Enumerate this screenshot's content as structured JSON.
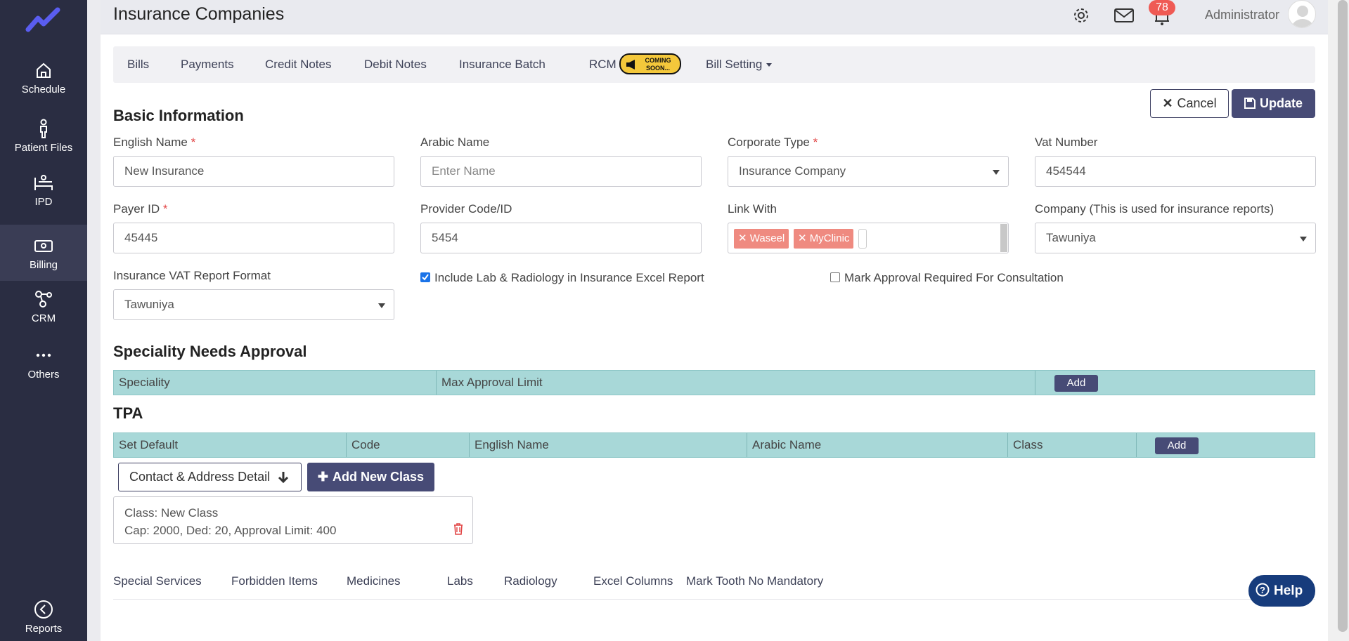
{
  "sidebar": {
    "items": [
      {
        "label": "Schedule",
        "icon": "home-icon"
      },
      {
        "label": "Patient Files",
        "icon": "person-icon"
      },
      {
        "label": "IPD",
        "icon": "bed-icon"
      },
      {
        "label": "Billing",
        "icon": "billing-icon"
      },
      {
        "label": "CRM",
        "icon": "crm-icon"
      },
      {
        "label": "Others",
        "icon": "more-icon"
      },
      {
        "label": "Reports",
        "icon": "back-circle-icon"
      }
    ],
    "active": "Billing"
  },
  "header": {
    "title": "Insurance Companies",
    "notification_count": "78",
    "user": "Administrator"
  },
  "tabs": [
    {
      "label": "Bills"
    },
    {
      "label": "Payments"
    },
    {
      "label": "Credit Notes"
    },
    {
      "label": "Debit Notes"
    },
    {
      "label": "Insurance Batch"
    },
    {
      "label": "RCM"
    },
    {
      "label": "Bill Setting"
    }
  ],
  "coming_soon": "COMING SOON...",
  "actions": {
    "cancel": "Cancel",
    "update": "Update"
  },
  "basic": {
    "heading": "Basic Information",
    "english_name": {
      "label": "English Name",
      "value": "New Insurance"
    },
    "arabic_name": {
      "label": "Arabic Name",
      "placeholder": "Enter Name"
    },
    "corporate_type": {
      "label": "Corporate Type",
      "value": "Insurance Company"
    },
    "vat_number": {
      "label": "Vat Number",
      "value": "454544"
    },
    "payer_id": {
      "label": "Payer ID",
      "value": "45445"
    },
    "provider_code": {
      "label": "Provider Code/ID",
      "value": "5454"
    },
    "link_with": {
      "label": "Link With",
      "chips": [
        "Waseel",
        "MyClinic"
      ]
    },
    "company": {
      "label": "Company (This is used for insurance reports)",
      "value": "Tawuniya"
    },
    "vat_report": {
      "label": "Insurance VAT Report Format",
      "value": "Tawuniya"
    },
    "include_lab": {
      "label": "Include Lab & Radiology in Insurance Excel Report",
      "checked": true
    },
    "mark_approval": {
      "label": "Mark Approval Required For Consultation",
      "checked": false
    }
  },
  "speciality": {
    "heading": "Speciality Needs Approval",
    "columns": [
      "Speciality",
      "Max Approval Limit"
    ],
    "add": "Add"
  },
  "tpa": {
    "heading": "TPA",
    "columns": [
      "Set Default",
      "Code",
      "English Name",
      "Arabic Name",
      "Class"
    ],
    "add": "Add"
  },
  "buttons": {
    "contact": "Contact & Address Detail",
    "add_class": "Add New Class"
  },
  "class_card": {
    "line1": "Class: New Class",
    "line2": "Cap: 2000, Ded: 20, Approval Limit: 400"
  },
  "bottom_tabs": [
    "Special Services",
    "Forbidden Items",
    "Medicines",
    "Labs",
    "Radiology",
    "Excel Columns",
    "Mark Tooth No Mandatory"
  ],
  "help": "Help",
  "colors": {
    "sidebar": "#2a2d42",
    "primary": "#474b76",
    "table_header": "#a8d8d8",
    "chip": "#ef8a80",
    "help": "#173c7c"
  }
}
